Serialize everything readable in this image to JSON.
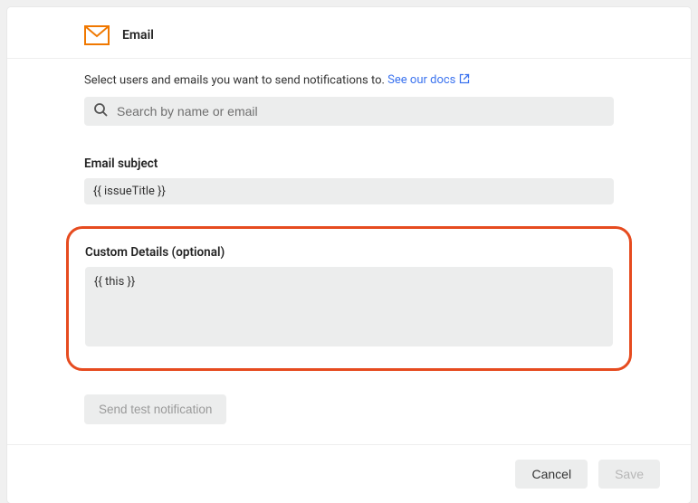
{
  "header": {
    "title": "Email"
  },
  "intro": {
    "text": "Select users and emails you want to send notifications to. ",
    "linkText": "See our docs"
  },
  "search": {
    "placeholder": "Search by name or email"
  },
  "subject": {
    "label": "Email subject",
    "value": "{{ issueTitle }}"
  },
  "customDetails": {
    "label": "Custom Details (optional)",
    "value": "{{ this }}"
  },
  "buttons": {
    "sendTest": "Send test notification",
    "cancel": "Cancel",
    "save": "Save"
  }
}
